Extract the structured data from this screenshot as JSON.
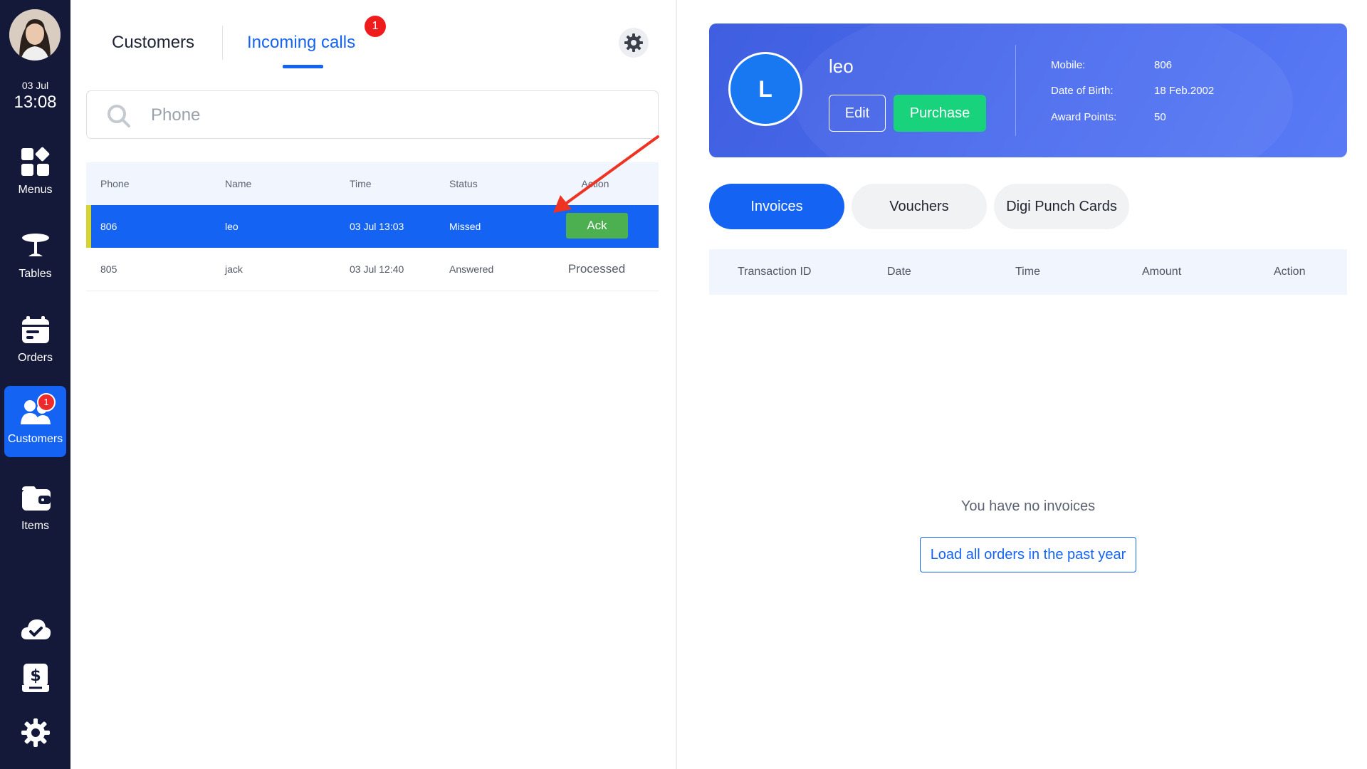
{
  "sidebar": {
    "date": "03 Jul",
    "time": "13:08",
    "items": [
      {
        "label": "Menus",
        "icon": "menus-grid-icon"
      },
      {
        "label": "Tables",
        "icon": "table-icon"
      },
      {
        "label": "Orders",
        "icon": "orders-icon"
      },
      {
        "label": "Customers",
        "icon": "customers-icon",
        "badge": "1",
        "active": true
      },
      {
        "label": "Items",
        "icon": "items-wallet-icon"
      }
    ],
    "bottom_icons": [
      "cloud-check-icon",
      "cash-register-icon",
      "gear-icon"
    ]
  },
  "left_panel": {
    "tabs": {
      "customers": "Customers",
      "incoming_calls": "Incoming calls",
      "incoming_badge": "1"
    },
    "search": {
      "placeholder": "Phone",
      "value": ""
    },
    "table": {
      "headers": {
        "phone": "Phone",
        "name": "Name",
        "time": "Time",
        "status": "Status",
        "action": "Action"
      },
      "rows": [
        {
          "phone": "806",
          "name": "leo",
          "time": "03 Jul 13:03",
          "status": "Missed",
          "action": "Ack",
          "selected": true
        },
        {
          "phone": "805",
          "name": "jack",
          "time": "03 Jul 12:40",
          "status": "Answered",
          "action": "Processed",
          "selected": false
        }
      ]
    }
  },
  "profile": {
    "initial": "L",
    "name": "leo",
    "edit_label": "Edit",
    "purchase_label": "Purchase",
    "info": {
      "mobile_label": "Mobile:",
      "mobile": "806",
      "dob_label": "Date of Birth:",
      "dob": "18 Feb.2002",
      "points_label": "Award Points:",
      "points": "50"
    }
  },
  "right_tabs": {
    "invoices": "Invoices",
    "vouchers": "Vouchers",
    "punch_cards": "Digi Punch Cards"
  },
  "invoices_table": {
    "headers": {
      "transaction_id": "Transaction ID",
      "date": "Date",
      "time": "Time",
      "amount": "Amount",
      "action": "Action"
    },
    "empty_message": "You have no invoices",
    "load_button": "Load all orders in the past year"
  },
  "colors": {
    "sidebar_bg": "#14193a",
    "accent": "#1463f3",
    "ack_green": "#4caf50",
    "purchase_green": "#18d37c",
    "badge_red": "#ee1c1c",
    "annotation_arrow": "#ee3322"
  }
}
